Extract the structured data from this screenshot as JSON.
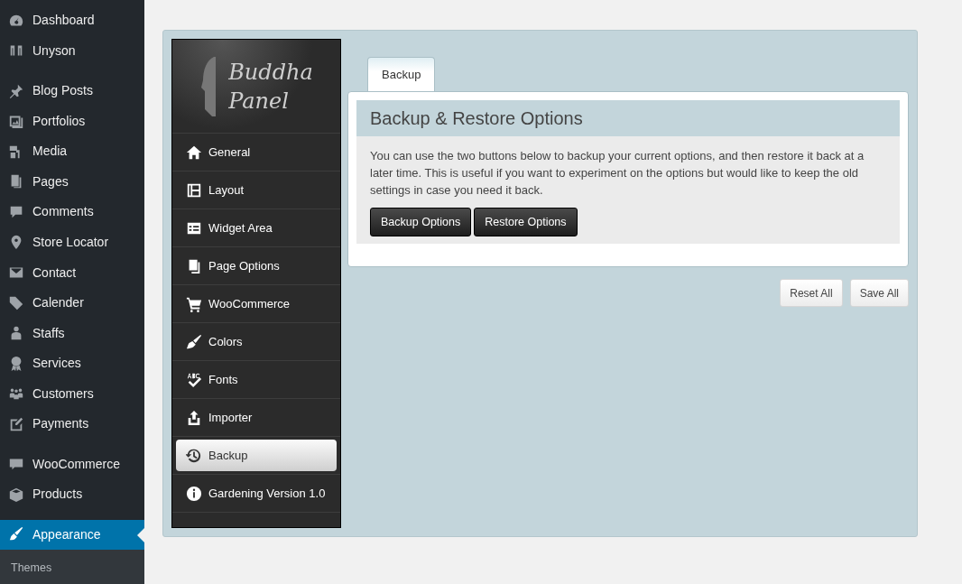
{
  "admin_menu": {
    "groups": [
      {
        "items": [
          {
            "label": "Dashboard",
            "selected": false
          },
          {
            "label": "Unyson",
            "selected": false
          }
        ]
      },
      {
        "items": [
          {
            "label": "Blog Posts",
            "selected": false
          },
          {
            "label": "Portfolios",
            "selected": false
          },
          {
            "label": "Media",
            "selected": false
          },
          {
            "label": "Pages",
            "selected": false
          },
          {
            "label": "Comments",
            "selected": false
          },
          {
            "label": "Store Locator",
            "selected": false
          },
          {
            "label": "Contact",
            "selected": false
          },
          {
            "label": "Calender",
            "selected": false
          },
          {
            "label": "Staffs",
            "selected": false
          },
          {
            "label": "Services",
            "selected": false
          },
          {
            "label": "Customers",
            "selected": false
          },
          {
            "label": "Payments",
            "selected": false
          }
        ]
      },
      {
        "items": [
          {
            "label": "WooCommerce",
            "selected": false
          },
          {
            "label": "Products",
            "selected": false
          }
        ]
      },
      {
        "items": [
          {
            "label": "Appearance",
            "selected": true
          }
        ]
      }
    ],
    "submenu": [
      "Themes"
    ]
  },
  "panel": {
    "logo": {
      "line1": "Buddha",
      "line2": "Panel"
    },
    "nav": [
      {
        "label": "General",
        "selected": false
      },
      {
        "label": "Layout",
        "selected": false
      },
      {
        "label": "Widget Area",
        "selected": false
      },
      {
        "label": "Page Options",
        "selected": false
      },
      {
        "label": "WooCommerce",
        "selected": false
      },
      {
        "label": "Colors",
        "selected": false
      },
      {
        "label": "Fonts",
        "selected": false
      },
      {
        "label": "Importer",
        "selected": false
      },
      {
        "label": "Backup",
        "selected": true
      },
      {
        "label": "Gardening Version 1.0",
        "selected": false
      }
    ],
    "tabs": [
      {
        "label": "Backup",
        "selected": true
      }
    ],
    "section": {
      "title": "Backup & Restore Options",
      "description": "You can use the two buttons below to backup your current options, and then restore it back at a later time. This is useful if you want to experiment on the options but would like to keep the old settings in case you need it back.",
      "buttons": [
        "Backup Options",
        "Restore Options"
      ]
    },
    "footer_buttons": [
      "Reset All",
      "Save All"
    ]
  }
}
